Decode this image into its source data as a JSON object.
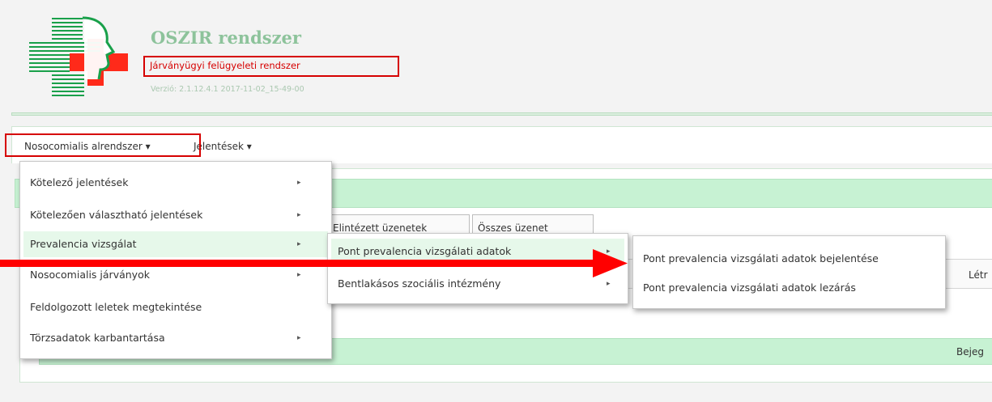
{
  "header": {
    "title": "OSZIR rendszer",
    "subtitle": "Járványügyi felügyeleti rendszer",
    "version": "Verzió: 2.1.12.4.1 2017-11-02_15-49-00",
    "logo_icon": "medical-cross-head-logo-icon"
  },
  "menubar": {
    "items": [
      {
        "label": "Nosocomialis alrendszer ▾"
      },
      {
        "label": "Jelentések ▾"
      }
    ]
  },
  "main_menu": {
    "items": [
      {
        "label": "Kötelező jelentések",
        "caret": "▸"
      },
      {
        "label": "Kötelezően választható jelentések",
        "caret": "▸"
      },
      {
        "label": "Prevalencia vizsgálat",
        "caret": "▸"
      },
      {
        "label": "Nosocomialis járványok",
        "caret": "▸"
      },
      {
        "label": "Feldolgozott leletek megtekintése",
        "caret": ""
      },
      {
        "label": "Törzsadatok karbantartása",
        "caret": "▸"
      }
    ]
  },
  "prevalencia_submenu": {
    "items": [
      {
        "label": "Pont prevalencia vizsgálati adatok",
        "caret": "▸"
      },
      {
        "label": "Bentlakásos szociális intézmény",
        "caret": "▸"
      }
    ]
  },
  "pont_submenu": {
    "items": [
      {
        "label": "Pont prevalencia vizsgálati adatok bejelentése"
      },
      {
        "label": "Pont prevalencia vizsgálati adatok lezárás"
      }
    ]
  },
  "background": {
    "tabs": [
      {
        "label": "Elintézett üzenetek"
      },
      {
        "label": "Összes üzenet"
      }
    ],
    "table_header_partial": "Létr",
    "bottom_bar_partial": "Bejeg"
  },
  "colors": {
    "brand_green": "#8dc39b",
    "highlight_red": "#d60000",
    "menu_green": "#c7f2d3",
    "arrow_red": "#ff0000"
  }
}
